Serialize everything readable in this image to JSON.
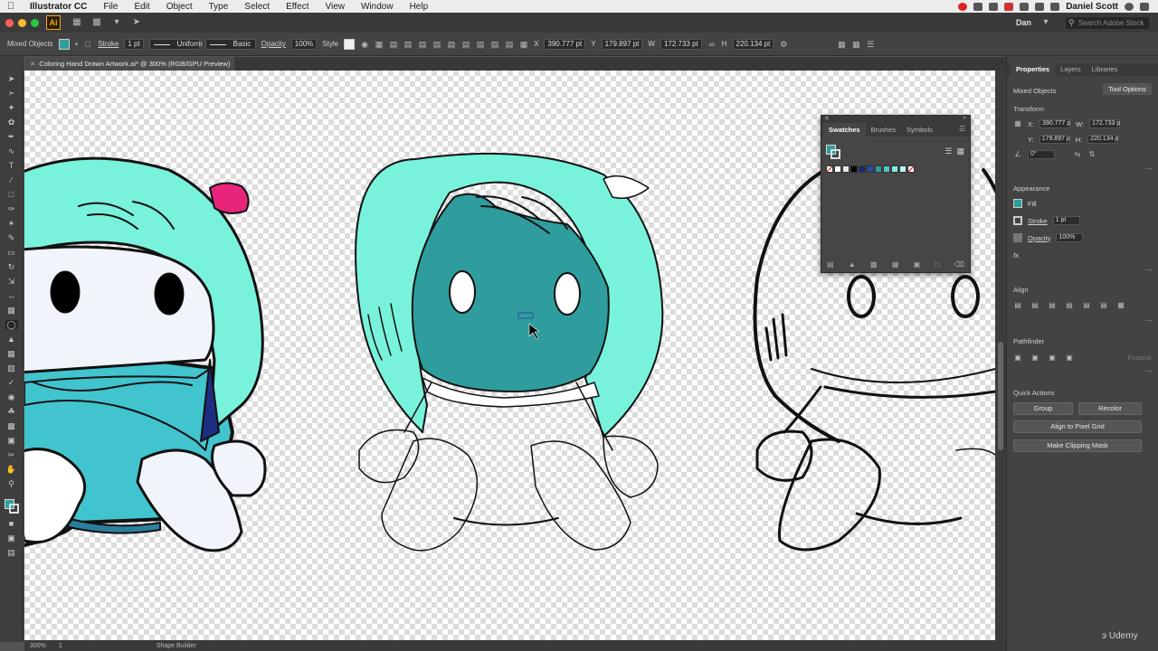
{
  "menubar": {
    "apple": "",
    "app_name": "Illustrator CC",
    "items": [
      "File",
      "Edit",
      "Object",
      "Type",
      "Select",
      "Effect",
      "View",
      "Window",
      "Help"
    ],
    "user": "Daniel Scott"
  },
  "appbar": {
    "logo": "Ai",
    "workspace_user": "Dan",
    "search_placeholder": "Search Adobe Stock",
    "traffic_colors": [
      "#fc5f57",
      "#fdbc2e",
      "#28c840"
    ]
  },
  "control": {
    "selection": "Mixed Objects",
    "fill_color": "#2f9d9d",
    "stroke_label": "Stroke",
    "stroke_weight": "1 pt",
    "stroke_profile": "Uniform",
    "brush": "Basic",
    "opacity_label": "Opacity",
    "opacity": "100%",
    "style_label": "Style",
    "x_label": "X",
    "x": "390.777 pt",
    "y_label": "Y",
    "y": "179.897 pt",
    "w_label": "W",
    "w": "172.733 pt",
    "h_label": "H",
    "h": "220.134 pt"
  },
  "document": {
    "tab_title": "Coloring Hand Drawn Artwork.ai* @ 300% (RGB/GPU Preview)"
  },
  "status": {
    "zoom": "300%",
    "artboard": "1",
    "tool": "Shape Builder"
  },
  "swatches_panel": {
    "tabs": [
      "Swatches",
      "Brushes",
      "Symbols"
    ],
    "colors": [
      "#ffffff",
      "#e6e6e6",
      "#000000",
      "#1d2a6b",
      "#2b4aa0",
      "#2f9d9d",
      "#4fc3c7",
      "#7ff2de",
      "#b8f7ee",
      "#ffffff"
    ]
  },
  "properties": {
    "tabs": [
      "Properties",
      "Layers",
      "Libraries"
    ],
    "selection": "Mixed Objects",
    "tool_options": "Tool Options",
    "transform_label": "Transform",
    "x_label": "X:",
    "x": "390.777 p",
    "y_label": "Y:",
    "y": "179.897 p",
    "w_label": "W:",
    "w": "172.733 p",
    "h_label": "H:",
    "h": "220.134 p",
    "angle": "0°",
    "appearance_label": "Appearance",
    "fill_label": "Fill",
    "stroke_label": "Stroke",
    "stroke_weight": "1 pt",
    "opacity_label": "Opacity",
    "opacity": "100%",
    "fx": "fx.",
    "align_label": "Align",
    "pathfinder_label": "Pathfinder",
    "expand": "Expand",
    "quick_actions_label": "Quick Actions",
    "group": "Group",
    "recolor": "Recolor",
    "align_pixel": "Align to Pixel Grid",
    "clipping_mask": "Make Clipping Mask"
  },
  "watermark": "Udemy"
}
